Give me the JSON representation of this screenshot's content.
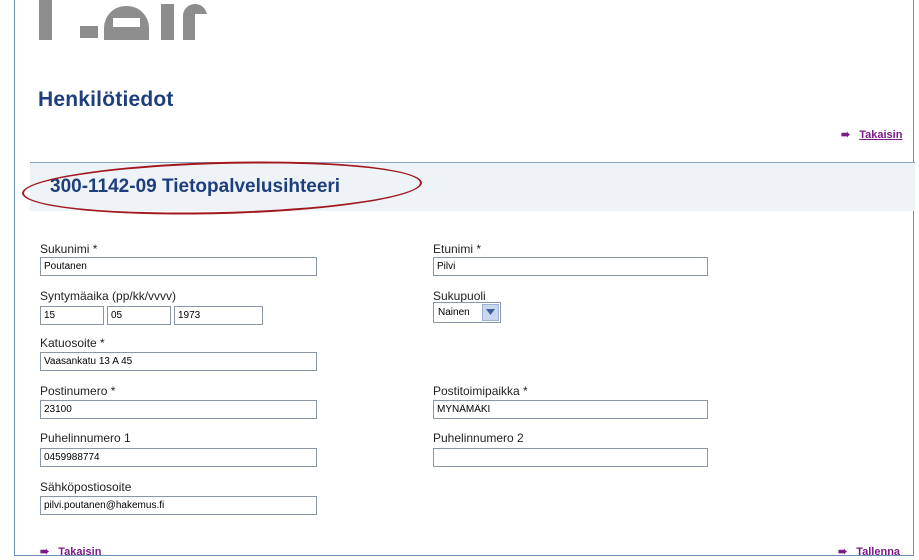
{
  "page": {
    "title": "Henkilötiedot",
    "section_title": "300-1142-09 Tietopalvelusihteeri"
  },
  "links": {
    "back_top": "Takaisin",
    "back_bottom": "Takaisin",
    "save_bottom": "Tallenna"
  },
  "fields": {
    "sukunimi": {
      "label": "Sukunimi *",
      "value": "Poutanen"
    },
    "etunimi": {
      "label": "Etunimi *",
      "value": "Pilvi"
    },
    "syntymaaika": {
      "label": "Syntymäaika (pp/kk/vvvv)",
      "day": "15",
      "month": "05",
      "year": "1973"
    },
    "sukupuoli": {
      "label": "Sukupuoli",
      "value": "Nainen"
    },
    "katuosoite": {
      "label": "Katuosoite *",
      "value": "Vaasankatu 13 A 45"
    },
    "postinumero": {
      "label": "Postinumero *",
      "value": "23100"
    },
    "postitoimipaikka": {
      "label": "Postitoimipaikka *",
      "value": "MYNÄMÄKI"
    },
    "puhelin1": {
      "label": "Puhelinnumero 1",
      "value": "0459988774"
    },
    "puhelin2": {
      "label": "Puhelinnumero 2",
      "value": ""
    },
    "sahkoposti": {
      "label": "Sähköpostiosoite",
      "value": "pilvi.poutanen@hakemus.fi"
    }
  },
  "colors": {
    "title_blue": "#1e3f7c",
    "link_purple": "#7a1c86",
    "annotation_red": "#a1181e",
    "band_bg": "#eef3f8"
  }
}
